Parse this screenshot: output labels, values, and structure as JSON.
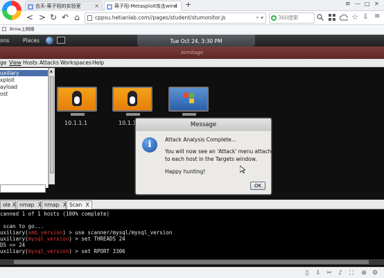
{
  "browser": {
    "tabs": [
      {
        "title": "合天-蒋子阳的实验室",
        "close": "×"
      },
      {
        "title": "蒋子阳-Metasploit攻击wind",
        "close": "×"
      }
    ],
    "new_tab": "+",
    "window_controls": {
      "menu": "≡",
      "minimize": "—",
      "maximize": "□",
      "close": "✕"
    },
    "nav": {
      "back": "<",
      "forward": ">",
      "reload": "↻",
      "undo": "↶",
      "home": "⌂"
    },
    "url": "cppsu.hetianlab.com//pages/student/stumonitor.js",
    "url_suffix": "⚡ ▾",
    "search_placeholder": "360搜索",
    "bookmark": "Brow上网络"
  },
  "desktop": {
    "panel": {
      "apps": "ons",
      "places": "Places",
      "clock": "Tue Oct 24,  3:30 PM"
    },
    "window_title": "Armitage",
    "menu": [
      "ge",
      "View",
      "Hosts",
      "Attacks",
      "Workspaces",
      "Help"
    ],
    "tree": [
      "uxiliary",
      "xploit",
      "ayload",
      "ost"
    ],
    "hosts": [
      {
        "label": "10.1.1.1",
        "os": "linux"
      },
      {
        "label": "10.1.1.",
        "os": "linux"
      },
      {
        "label": "",
        "os": "windows"
      }
    ],
    "console_tabs": [
      {
        "label": "ole",
        "close": "X"
      },
      {
        "label": "nmap",
        "close": "X"
      },
      {
        "label": "nmap",
        "close": "X"
      },
      {
        "label": "Scan",
        "close": "X"
      }
    ],
    "console_lines": [
      {
        "pre": "canned 1 of 1 hosts (100% complete)",
        "mod": "",
        "post": ""
      },
      {
        "pre": "",
        "mod": "",
        "post": ""
      },
      {
        "pre": " scan to go...",
        "mod": "",
        "post": ""
      },
      {
        "pre": "uxiliary(",
        "mod": "smb_version",
        "post": ") > use scanner/mysql/mysql_version"
      },
      {
        "pre": "uxiliary(",
        "mod": "mysql_version",
        "post": ") > set THREADS 24"
      },
      {
        "pre": "DS => 24",
        "mod": "",
        "post": ""
      },
      {
        "pre": "uxiliary(",
        "mod": "mysql_version",
        "post": ") > set RPORT 3306"
      }
    ],
    "dialog": {
      "title": "Message",
      "icon": "i",
      "line1": "Attack Analysis Complete...",
      "line2": "You will now see an 'Attack' menu attached",
      "line3": "to each host in the Targets window.",
      "line4": "Happy hunting!",
      "ok": "OK"
    }
  }
}
